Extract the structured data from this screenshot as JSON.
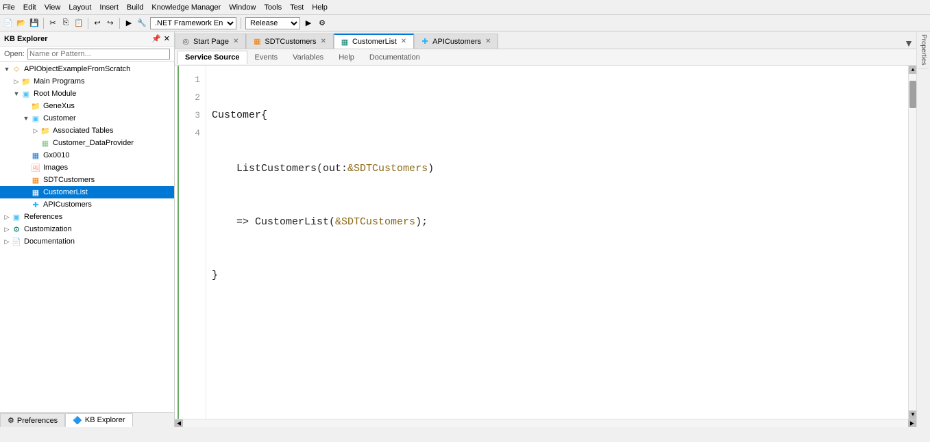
{
  "toolbar": {
    "menu_items": [
      "File",
      "Edit",
      "View",
      "Layout",
      "Insert",
      "Build",
      "Knowledge Manager",
      "Window",
      "Tools",
      "Test",
      "Help"
    ],
    "framework": ".NET Framework En",
    "release": "Release"
  },
  "sidebar": {
    "title": "KB Explorer",
    "open_label": "Open:",
    "open_placeholder": "Name or Pattern...",
    "tree": [
      {
        "id": "root",
        "label": "APIObjectExampleFromScratch",
        "indent": 0,
        "expand": "▼",
        "icon": "⬦",
        "icon_class": "icon-root"
      },
      {
        "id": "main_programs",
        "label": "Main Programs",
        "indent": 1,
        "expand": "▷",
        "icon": "📁",
        "icon_class": "icon-folder"
      },
      {
        "id": "root_module",
        "label": "Root Module",
        "indent": 1,
        "expand": "▼",
        "icon": "▣",
        "icon_class": "icon-module"
      },
      {
        "id": "genexus",
        "label": "GeneXus",
        "indent": 2,
        "expand": "",
        "icon": "📁",
        "icon_class": "icon-folder"
      },
      {
        "id": "customer",
        "label": "Customer",
        "indent": 2,
        "expand": "▼",
        "icon": "▣",
        "icon_class": "icon-module"
      },
      {
        "id": "associated_tables",
        "label": "Associated Tables",
        "indent": 3,
        "expand": "▷",
        "icon": "📁",
        "icon_class": "icon-folder"
      },
      {
        "id": "customer_dp",
        "label": "Customer_DataProvider",
        "indent": 3,
        "expand": "",
        "icon": "▦",
        "icon_class": "icon-green"
      },
      {
        "id": "gx0010",
        "label": "Gx0010",
        "indent": 2,
        "expand": "",
        "icon": "▦",
        "icon_class": "icon-blue"
      },
      {
        "id": "images",
        "label": "Images",
        "indent": 2,
        "expand": "",
        "icon": "🖼",
        "icon_class": "icon-img"
      },
      {
        "id": "sdtcustomers",
        "label": "SDTCustomers",
        "indent": 2,
        "expand": "",
        "icon": "▦",
        "icon_class": "icon-orange"
      },
      {
        "id": "customerlist",
        "label": "CustomerList",
        "indent": 2,
        "expand": "",
        "icon": "▦",
        "icon_class": "icon-teal",
        "selected": true
      },
      {
        "id": "apicustomers",
        "label": "APICustomers",
        "indent": 2,
        "expand": "",
        "icon": "✚",
        "icon_class": "icon-api"
      },
      {
        "id": "references",
        "label": "References",
        "indent": 0,
        "expand": "▷",
        "icon": "▣",
        "icon_class": "icon-module"
      },
      {
        "id": "customization",
        "label": "Customization",
        "indent": 0,
        "expand": "▷",
        "icon": "⚙",
        "icon_class": "icon-teal"
      },
      {
        "id": "documentation",
        "label": "Documentation",
        "indent": 0,
        "expand": "▷",
        "icon": "📄",
        "icon_class": "icon-folder"
      }
    ]
  },
  "bottom_tabs": [
    {
      "label": "Preferences",
      "icon": "⚙",
      "active": false
    },
    {
      "label": "KB Explorer",
      "icon": "🔷",
      "active": true
    }
  ],
  "doc_tabs": [
    {
      "label": "Start Page",
      "icon": "◎",
      "icon_color": "#555",
      "closable": true,
      "active": false
    },
    {
      "label": "SDTCustomers",
      "icon": "▦",
      "icon_color": "#f57c00",
      "closable": true,
      "active": false
    },
    {
      "label": "CustomerList",
      "icon": "▦",
      "icon_color": "#00796b",
      "closable": true,
      "active": true
    },
    {
      "label": "APICustomers",
      "icon": "✚",
      "icon_color": "#29b6f6",
      "closable": true,
      "active": false
    }
  ],
  "sub_tabs": [
    {
      "label": "Service Source",
      "active": true
    },
    {
      "label": "Events",
      "active": false
    },
    {
      "label": "Variables",
      "active": false
    },
    {
      "label": "Help",
      "active": false
    },
    {
      "label": "Documentation",
      "active": false
    }
  ],
  "code": {
    "lines": [
      {
        "num": "1",
        "content": "Customer{",
        "parts": [
          {
            "text": "Customer",
            "class": "c-default"
          },
          {
            "text": "{",
            "class": "c-bracket"
          }
        ]
      },
      {
        "num": "2",
        "content": "    ListCustomers(out:&SDTCustomers)",
        "parts": [
          {
            "text": "    ListCustomers(out:",
            "class": "c-default"
          },
          {
            "text": "&SDTCustomers",
            "class": "c-link"
          },
          {
            "text": ")",
            "class": "c-default"
          }
        ]
      },
      {
        "num": "3",
        "content": "    => CustomerList(&SDTCustomers);",
        "parts": [
          {
            "text": "    => CustomerList(",
            "class": "c-default"
          },
          {
            "text": "&SDTCustomers",
            "class": "c-link"
          },
          {
            "text": ");",
            "class": "c-default"
          }
        ]
      },
      {
        "num": "4",
        "content": "}",
        "parts": [
          {
            "text": "}",
            "class": "c-bracket"
          }
        ]
      }
    ]
  },
  "right_panel_label": "Properties",
  "line_indicator": "4"
}
